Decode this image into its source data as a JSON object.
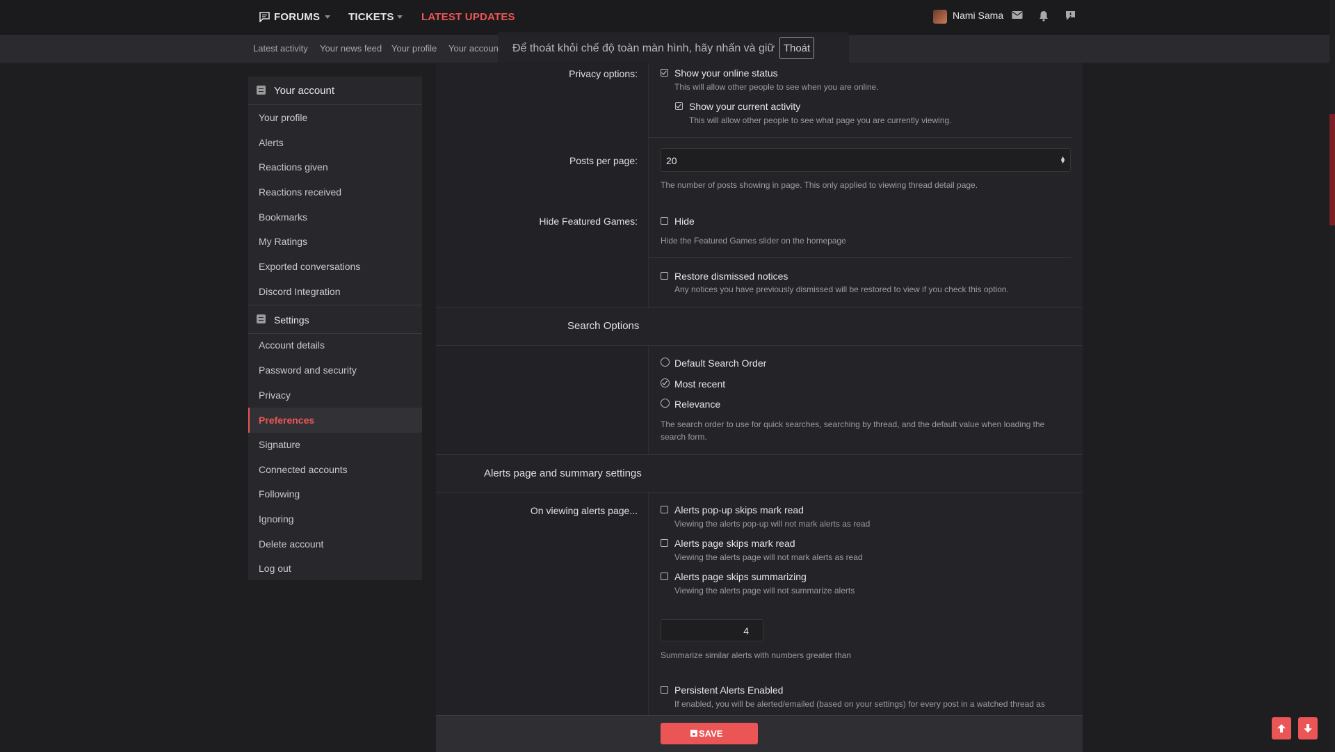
{
  "topnav": {
    "forums": "FORUMS",
    "tickets": "TICKETS",
    "latest_updates": "LATEST UPDATES",
    "username": "Nami Sama",
    "accent_color": "#ec5555"
  },
  "subnav": {
    "items": [
      "Latest activity",
      "Your news feed",
      "Your profile",
      "Your account"
    ],
    "fullscreen_notice": "Để thoát khỏi chế độ toàn màn hình, hãy nhấn và giữ",
    "fullscreen_exit": "Thoát"
  },
  "sidebar": {
    "account_header": "Your account",
    "account_items": [
      "Your profile",
      "Alerts",
      "Reactions given",
      "Reactions received",
      "Bookmarks",
      "My Ratings",
      "Exported conversations",
      "Discord Integration"
    ],
    "settings_header": "Settings",
    "settings_items": [
      "Account details",
      "Password and security",
      "Privacy",
      "Preferences",
      "Signature",
      "Connected accounts",
      "Following",
      "Ignoring",
      "Delete account",
      "Log out"
    ],
    "active_item": "Preferences"
  },
  "privacy": {
    "label": "Privacy options:",
    "online_status": "Show your online status",
    "online_status_hint": "This will allow other people to see when you are online.",
    "online_status_checked": true,
    "current_activity": "Show your current activity",
    "current_activity_hint": "This will allow other people to see what page you are currently viewing.",
    "current_activity_checked": true
  },
  "posts_per_page": {
    "label": "Posts per page:",
    "value": "20",
    "hint": "The number of posts showing in page. This only applied to viewing thread detail page."
  },
  "featured_games": {
    "label": "Hide Featured Games:",
    "option": "Hide",
    "hint": "Hide the Featured Games slider on the homepage",
    "checked": false
  },
  "restore_notices": {
    "option": "Restore dismissed notices",
    "hint": "Any notices you have previously dismissed will be restored to view if you check this option.",
    "checked": false
  },
  "search": {
    "heading": "Search Options",
    "options": [
      "Default Search Order",
      "Most recent",
      "Relevance"
    ],
    "selected": "Most recent",
    "hint": "The search order to use for quick searches, searching by thread, and the default value when loading the search form."
  },
  "alerts": {
    "heading": "Alerts page and summary settings",
    "label": "On viewing alerts page...",
    "popup_skip": "Alerts pop-up skips mark read",
    "popup_skip_hint": "Viewing the alerts pop-up will not mark alerts as read",
    "page_skip": "Alerts page skips mark read",
    "page_skip_hint": "Viewing the alerts page will not mark alerts as read",
    "page_skip_summarize": "Alerts page skips summarizing",
    "page_skip_summarize_hint": "Viewing the alerts page will not summarize alerts",
    "summarize_threshold": "4",
    "summarize_hint": "Summarize similar alerts with numbers greater than",
    "persistent": "Persistent Alerts Enabled",
    "persistent_hint": "If enabled, you will be alerted/emailed (based on your settings) for every post in a watched thread as"
  },
  "footer": {
    "save": "SAVE"
  },
  "icons": {
    "forums": "forum-bubble-icon",
    "mail": "envelope-icon",
    "alerts": "bell-icon",
    "report": "report-bubble-icon",
    "scroll_up": "arrow-up-icon",
    "scroll_down": "arrow-down-icon",
    "save": "floppy-disk-icon"
  }
}
